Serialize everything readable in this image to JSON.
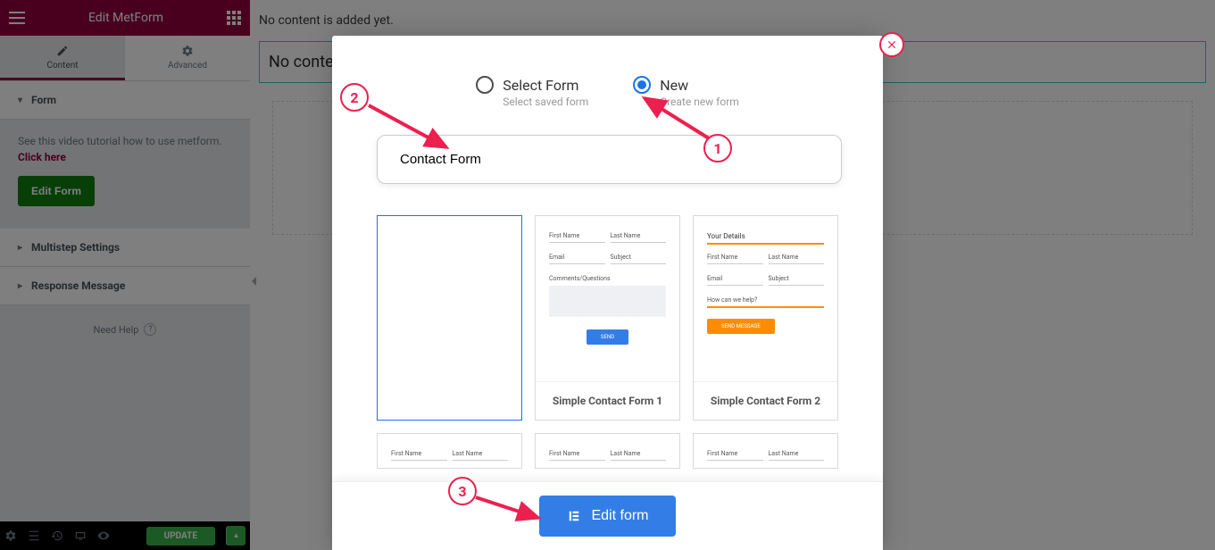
{
  "sidebar": {
    "title": "Edit MetForm",
    "tabs": {
      "content": "Content",
      "advanced": "Advanced"
    },
    "sections": {
      "form": "Form",
      "multistep": "Multistep Settings",
      "response": "Response Message"
    },
    "tutorial": "See this video tutorial how to use metform. ",
    "tutorial_link": "Click here",
    "edit_form_btn": "Edit Form",
    "need_help": "Need Help",
    "update_btn": "UPDATE"
  },
  "main": {
    "no_content_top": "No content is added yet.",
    "no_content_box": "No content"
  },
  "modal": {
    "select_form": "Select Form",
    "select_form_sub": "Select saved form",
    "new": "New",
    "new_sub": "Create new form",
    "form_name_value": "Contact Form",
    "template_blank": "",
    "template1": "Simple Contact Form 1",
    "template2": "Simple Contact Form 2",
    "edit_form_action": "Edit form",
    "preview": {
      "first_name": "First Name",
      "last_name": "Last Name",
      "email": "Email",
      "subject": "Subject",
      "comments": "Comments/Questions",
      "send": "SEND",
      "your_details": "Your Details",
      "how_help": "How can we help?",
      "send_message": "SEND MESSAGE"
    }
  },
  "annotations": {
    "a1": "1",
    "a2": "2",
    "a3": "3"
  }
}
